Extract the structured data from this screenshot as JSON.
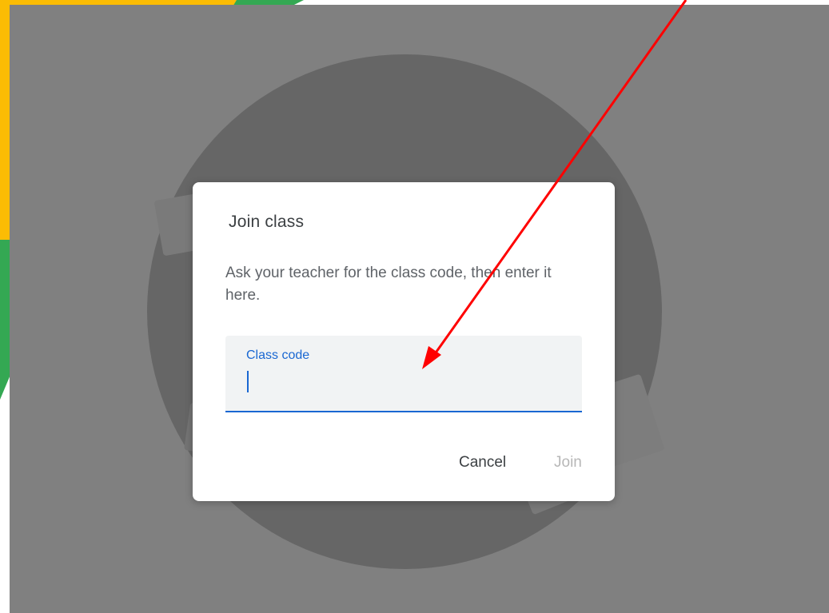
{
  "dialog": {
    "title": "Join class",
    "description": "Ask your teacher for the class code, then enter it here.",
    "field_label": "Class code",
    "field_value": "",
    "cancel_label": "Cancel",
    "join_label": "Join"
  },
  "colors": {
    "accent": "#1967d2",
    "frame_yellow": "#fbbc04",
    "frame_green": "#34a853",
    "arrow": "#ff0000",
    "overlay": "#808080"
  },
  "annotation": {
    "type": "red-arrow",
    "points_to": "class-code-field"
  }
}
